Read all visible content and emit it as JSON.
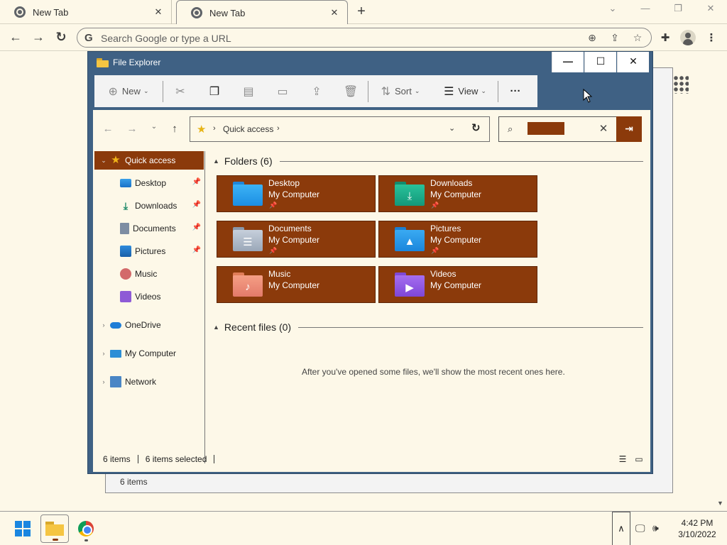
{
  "browser": {
    "tabs": [
      {
        "label": "New Tab"
      },
      {
        "label": "New Tab"
      }
    ],
    "new_tab": "+",
    "omnibox_placeholder": "Search Google or type a URL"
  },
  "background_window": {
    "status_items": "6 items"
  },
  "explorer": {
    "title": "File Explorer",
    "toolbar": {
      "new_label": "New",
      "sort_label": "Sort",
      "view_label": "View",
      "more_label": "···"
    },
    "address": {
      "location": "Quick access"
    },
    "nav": [
      {
        "label": "Quick access",
        "icon": "star-icon",
        "selected": true
      },
      {
        "label": "Desktop",
        "icon": "desktop-icon",
        "pinned": true
      },
      {
        "label": "Downloads",
        "icon": "download-icon",
        "pinned": true
      },
      {
        "label": "Documents",
        "icon": "documents-icon",
        "pinned": true
      },
      {
        "label": "Pictures",
        "icon": "pictures-icon",
        "pinned": true
      },
      {
        "label": "Music",
        "icon": "music-icon"
      },
      {
        "label": "Videos",
        "icon": "videos-icon"
      },
      {
        "label": "OneDrive",
        "icon": "onedrive-icon"
      },
      {
        "label": "My Computer",
        "icon": "computer-icon"
      },
      {
        "label": "Network",
        "icon": "network-icon"
      }
    ],
    "folders_header": "Folders (6)",
    "folders": [
      {
        "name": "Desktop",
        "location": "My Computer",
        "pinned": true,
        "icon": "desktop-folder-icon"
      },
      {
        "name": "Downloads",
        "location": "My Computer",
        "pinned": true,
        "icon": "downloads-folder-icon"
      },
      {
        "name": "Documents",
        "location": "My Computer",
        "pinned": true,
        "icon": "documents-folder-icon"
      },
      {
        "name": "Pictures",
        "location": "My Computer",
        "pinned": true,
        "icon": "pictures-folder-icon"
      },
      {
        "name": "Music",
        "location": "My Computer",
        "pinned": false,
        "icon": "music-folder-icon"
      },
      {
        "name": "Videos",
        "location": "My Computer",
        "pinned": false,
        "icon": "videos-folder-icon"
      }
    ],
    "recent_header": "Recent files (0)",
    "recent_empty": "After you've opened some files, we'll show the most recent ones here.",
    "status": {
      "items": "6 items",
      "selected": "6 items selected"
    },
    "colors": {
      "titlebar": "#3f6184",
      "accent": "#8b3a0b",
      "background": "#fdf8e8"
    }
  },
  "taskbar": {
    "time": "4:42 PM",
    "date": "3/10/2022"
  }
}
